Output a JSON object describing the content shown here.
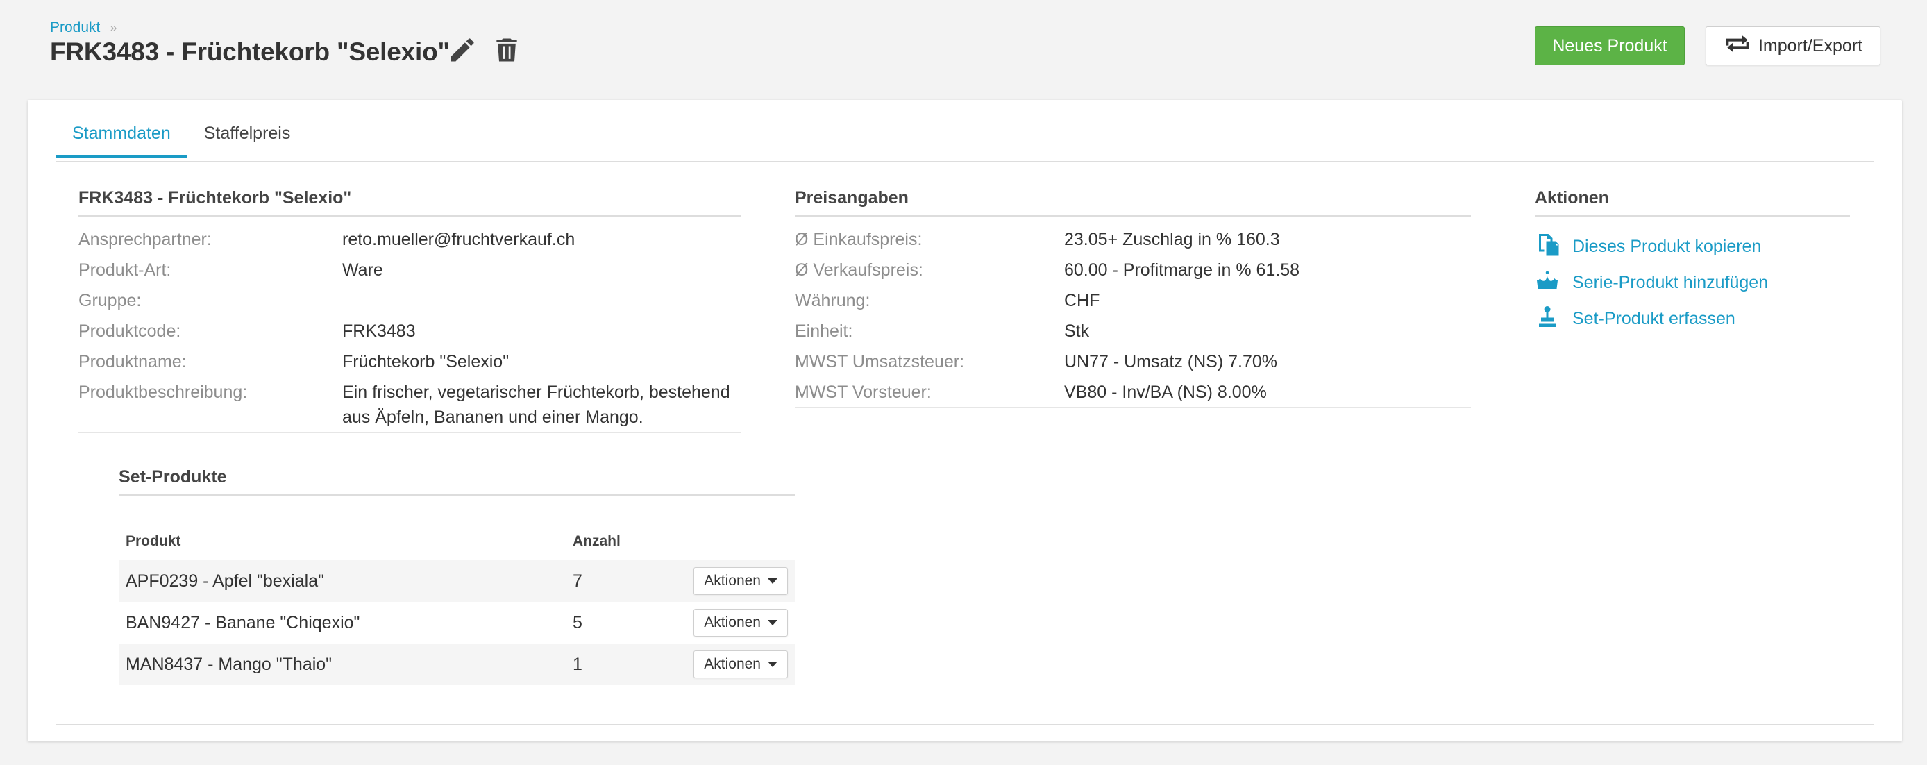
{
  "breadcrumb": {
    "parent": "Produkt",
    "separator": "»"
  },
  "page": {
    "title": "FRK3483 - Früchtekorb \"Selexio\""
  },
  "header_buttons": {
    "new_product": "Neues Produkt",
    "import_export": "Import/Export"
  },
  "tabs": [
    {
      "label": "Stammdaten",
      "active": true
    },
    {
      "label": "Staffelpreis",
      "active": false
    }
  ],
  "stammdaten": {
    "title": "FRK3483 - Früchtekorb \"Selexio\"",
    "rows": [
      {
        "label": "Ansprechpartner:",
        "value": "reto.mueller@fruchtverkauf.ch"
      },
      {
        "label": "Produkt-Art:",
        "value": "Ware"
      },
      {
        "label": "Gruppe:",
        "value": ""
      },
      {
        "label": "Produktcode:",
        "value": "FRK3483"
      },
      {
        "label": "Produktname:",
        "value": "Früchtekorb \"Selexio\""
      },
      {
        "label": "Produktbeschreibung:",
        "value": "Ein frischer, vegetarischer Früchtekorb, bestehend",
        "value2": "aus Äpfeln, Bananen und einer Mango."
      }
    ]
  },
  "preisangaben": {
    "title": "Preisangaben",
    "rows": [
      {
        "label": "Ø Einkaufspreis:",
        "value": "23.05+ Zuschlag in % 160.3"
      },
      {
        "label": "Ø Verkaufspreis:",
        "value": "60.00 - Profitmarge in % 61.58"
      },
      {
        "label": "Währung:",
        "value": "CHF"
      },
      {
        "label": "Einheit:",
        "value": "Stk"
      },
      {
        "label": "MWST Umsatzsteuer:",
        "value": "UN77 - Umsatz (NS) 7.70%"
      },
      {
        "label": "MWST Vorsteuer:",
        "value": "VB80 - Inv/BA (NS) 8.00%"
      }
    ]
  },
  "aktionen": {
    "title": "Aktionen",
    "items": [
      {
        "label": "Dieses Produkt kopieren",
        "icon": "copy-icon"
      },
      {
        "label": "Serie-Produkt hinzufügen",
        "icon": "crown-icon"
      },
      {
        "label": "Set-Produkt erfassen",
        "icon": "stamp-icon"
      }
    ]
  },
  "set_produkte": {
    "title": "Set-Produkte",
    "columns": {
      "product": "Produkt",
      "count": "Anzahl"
    },
    "action_label": "Aktionen",
    "rows": [
      {
        "product": "APF0239 - Apfel \"bexiala\"",
        "count": "7"
      },
      {
        "product": "BAN9427 - Banane \"Chiqexio\"",
        "count": "5"
      },
      {
        "product": "MAN8437 - Mango \"Thaio\"",
        "count": "1"
      }
    ]
  },
  "colors": {
    "accent": "#1a9bc6",
    "primary_button": "#5cb346",
    "label_gray": "#8d8d8d"
  }
}
